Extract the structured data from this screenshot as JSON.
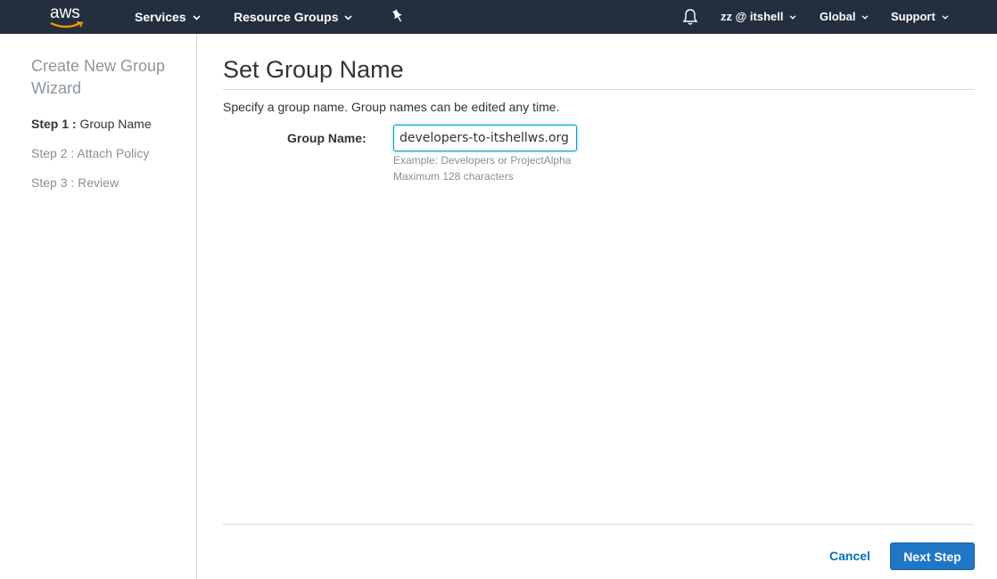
{
  "nav": {
    "logo_text": "aws",
    "services": "Services",
    "resource_groups": "Resource Groups",
    "pin_icon": "pin-icon",
    "bell_icon": "bell-icon",
    "account": "zz @ itshell",
    "region": "Global",
    "support": "Support"
  },
  "sidebar": {
    "title": "Create New Group Wizard",
    "steps": [
      {
        "num": "Step 1 :",
        "label": "Group Name",
        "active": true
      },
      {
        "num": "Step 2 :",
        "label": "Attach Policy",
        "active": false
      },
      {
        "num": "Step 3 :",
        "label": "Review",
        "active": false
      }
    ]
  },
  "main": {
    "title": "Set Group Name",
    "description": "Specify a group name. Group names can be edited any time.",
    "field_label": "Group Name:",
    "field_value": "developers-to-itshellws.org",
    "hint_example": "Example: Developers or ProjectAlpha",
    "hint_max": "Maximum 128 characters"
  },
  "footer": {
    "cancel_label": "Cancel",
    "next_label": "Next Step"
  },
  "colors": {
    "nav_bg": "#232f3e",
    "primary_button": "#1f77c5",
    "link": "#0073bb"
  }
}
